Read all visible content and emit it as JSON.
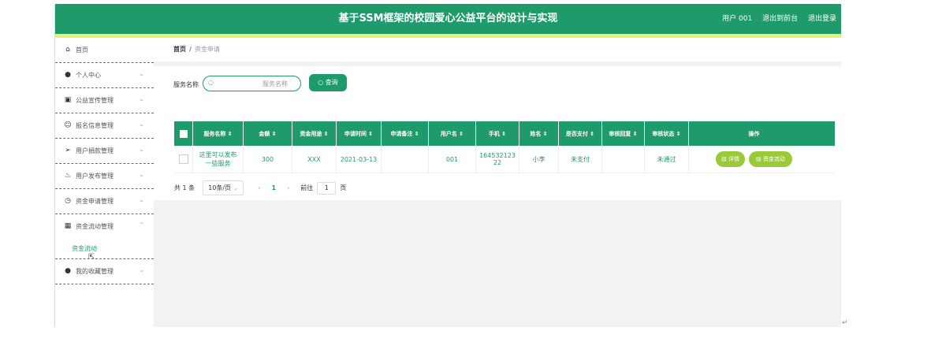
{
  "header": {
    "title": "基于SSM框架的校园爱心公益平台的设计与实现",
    "user": "用户 001",
    "to_front": "退出到前台",
    "logout": "退出登录"
  },
  "sidebar": {
    "items": [
      {
        "icon": "home-icon",
        "glyph": "⌂",
        "label": "首页",
        "chev": ""
      },
      {
        "icon": "user-icon",
        "glyph": "●",
        "label": "个人中心",
        "chev": "⌄"
      },
      {
        "icon": "clipboard-icon",
        "glyph": "▣",
        "label": "公益宣传管理",
        "chev": "⌄"
      },
      {
        "icon": "smile-icon",
        "glyph": "☺",
        "label": "报名信息管理",
        "chev": "⌄"
      },
      {
        "icon": "send-icon",
        "glyph": "➢",
        "label": "用户捐款管理",
        "chev": "⌄"
      },
      {
        "icon": "magic-icon",
        "glyph": "♨",
        "label": "用户发布管理",
        "chev": "⌄"
      },
      {
        "icon": "clock-icon",
        "glyph": "◷",
        "label": "资金申请管理",
        "chev": "⌄"
      },
      {
        "icon": "ticket-icon",
        "glyph": "▦",
        "label": "资金流动管理",
        "chev": "⌃"
      }
    ],
    "sub_item": "资金流动",
    "last_item": {
      "icon": "user-icon",
      "glyph": "●",
      "label": "我的收藏管理",
      "chev": "⌄"
    }
  },
  "breadcrumb": {
    "home": "首页",
    "sep": "/",
    "current": "资金申请"
  },
  "search": {
    "label": "服务名称",
    "placeholder": "服务名称",
    "button": "查询"
  },
  "table": {
    "headers": [
      "服务名称 ⇕",
      "金额 ⇕",
      "资金用途 ⇕",
      "申请时间 ⇕",
      "申请备注 ⇕",
      "用户名 ⇕",
      "手机 ⇕",
      "姓名 ⇕",
      "是否支付 ⇕",
      "审核回复 ⇕",
      "审核状态 ⇕",
      "操作"
    ],
    "rows": [
      {
        "service": "这里可以发布一些服务",
        "amount": "300",
        "usage": "XXX",
        "date": "2021-03-13",
        "remark": "",
        "username": "001",
        "phone": "16453212322",
        "name": "小李",
        "paid": "未支付",
        "reply": "",
        "status": "未通过",
        "detail_btn": "详情",
        "flow_btn": "资金流动"
      }
    ]
  },
  "pager": {
    "total": "共 1 条",
    "page_size": "10条/页",
    "current": "1",
    "goto": "前往",
    "goto_value": "1",
    "page_unit": "页"
  }
}
